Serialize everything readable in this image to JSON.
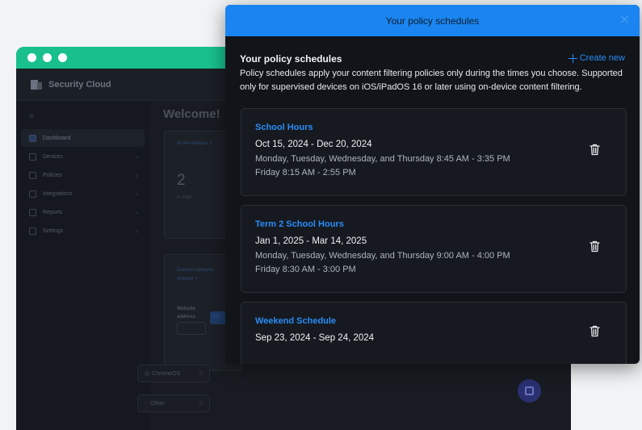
{
  "background_app": {
    "brand": "Security Cloud",
    "welcome": "Welcome!",
    "nav": [
      {
        "label": "Dashboard",
        "icon": "dashboard-icon",
        "active": true
      },
      {
        "label": "Devices",
        "icon": "devices-icon"
      },
      {
        "label": "Policies",
        "icon": "policies-icon"
      },
      {
        "label": "Integrations",
        "icon": "integrations-icon"
      },
      {
        "label": "Reports",
        "icon": "reports-icon"
      },
      {
        "label": "Settings",
        "icon": "settings-icon"
      }
    ],
    "active_devices": {
      "label": "Active devices >",
      "count": "2",
      "sub": "in total"
    },
    "domain_checker": {
      "label": "Domain category checker >",
      "website_label": "Website address",
      "button": "Ch"
    },
    "os_rows": [
      {
        "label": "ChromeOS",
        "count": "0"
      },
      {
        "label": "Other",
        "count": "0"
      }
    ]
  },
  "modal": {
    "header_title": "Your policy schedules",
    "section_title": "Your policy schedules",
    "create_new": "Create new",
    "description": "Policy schedules apply your content filtering policies only during the times you choose. Supported only for supervised devices on iOS/iPadOS 16 or later using on-device content filtering.",
    "schedules": [
      {
        "name": "School Hours",
        "range": "Oct 15, 2024 - Dec 20, 2024",
        "line1": "Monday, Tuesday, Wednesday, and Thursday 8:45 AM - 3:35 PM",
        "line2": "Friday 8:15 AM - 2:55 PM"
      },
      {
        "name": "Term 2 School Hours",
        "range": "Jan 1, 2025 - Mar 14, 2025",
        "line1": "Monday, Tuesday, Wednesday, and Thursday 9:00 AM - 4:00 PM",
        "line2": "Friday 8:30 AM - 3:00 PM"
      },
      {
        "name": "Weekend Schedule",
        "range": "Sep 23, 2024 - Sep 24, 2024"
      }
    ]
  },
  "colors": {
    "accent": "#1a85f0",
    "window_bar": "#19c08e"
  }
}
